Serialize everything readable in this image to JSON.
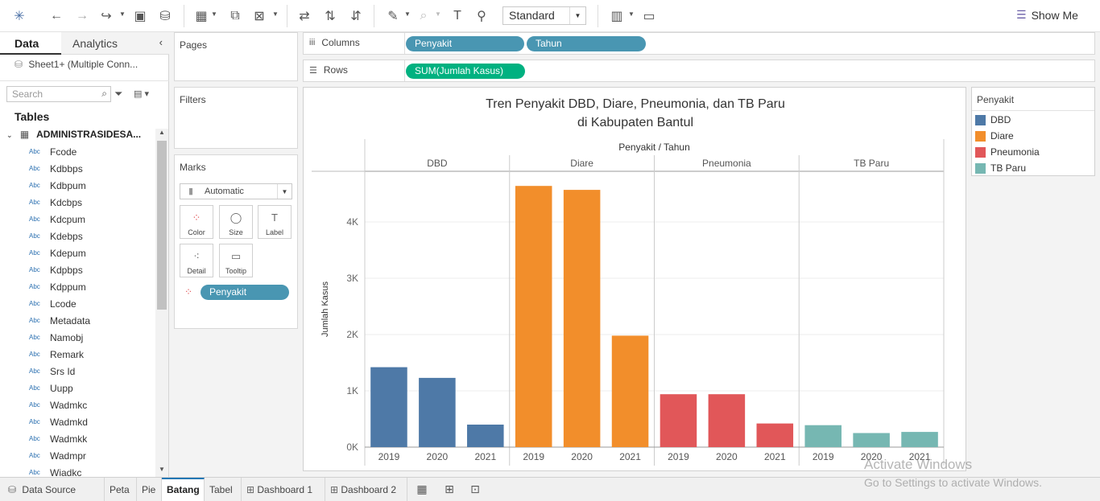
{
  "toolbar": {
    "fit_select": "Standard",
    "show_me": "Show Me"
  },
  "datapane": {
    "tab_data": "Data",
    "tab_analytics": "Analytics",
    "connection": "Sheet1+ (Multiple Conn...",
    "search_placeholder": "Search",
    "tables_heading": "Tables",
    "table_name": "ADMINISTRASIDESA...",
    "field_type": "Abc",
    "fields": [
      "Fcode",
      "Kdbbps",
      "Kdbpum",
      "Kdcbps",
      "Kdcpum",
      "Kdebps",
      "Kdepum",
      "Kdpbps",
      "Kdppum",
      "Lcode",
      "Metadata",
      "Namobj",
      "Remark",
      "Srs Id",
      "Uupp",
      "Wadmkc",
      "Wadmkd",
      "Wadmkk",
      "Wadmpr",
      "Wiadkc"
    ]
  },
  "cards": {
    "pages": "Pages",
    "filters": "Filters",
    "marks": "Marks",
    "marks_type": "Automatic",
    "mark_buttons": [
      "Color",
      "Size",
      "Label",
      "Detail",
      "Tooltip"
    ],
    "marks_pill": "Penyakit"
  },
  "shelves": {
    "columns_label": "Columns",
    "rows_label": "Rows",
    "columns_pills": [
      "Penyakit",
      "Tahun"
    ],
    "rows_pill": "SUM(Jumlah Kasus)"
  },
  "legend": {
    "title": "Penyakit",
    "items": [
      {
        "label": "DBD",
        "color": "#4e79a7"
      },
      {
        "label": "Diare",
        "color": "#f28e2b"
      },
      {
        "label": "Pneumonia",
        "color": "#e15759"
      },
      {
        "label": "TB Paru",
        "color": "#76b7b2"
      }
    ]
  },
  "chart_data": {
    "type": "bar",
    "title_line1": "Tren Penyakit DBD, Diare, Pneumonia, dan TB Paru",
    "title_line2": "di Kabupaten Bantul",
    "header": "Penyakit / Tahun",
    "ylabel": "Jumlah Kasus",
    "ylim": [
      0,
      4900
    ],
    "yticks": [
      {
        "v": 0,
        "label": "0K"
      },
      {
        "v": 1000,
        "label": "1K"
      },
      {
        "v": 2000,
        "label": "2K"
      },
      {
        "v": 3000,
        "label": "3K"
      },
      {
        "v": 4000,
        "label": "4K"
      }
    ],
    "grid": true,
    "groups": [
      {
        "name": "DBD",
        "color": "#4e79a7",
        "categories": [
          "2019",
          "2020",
          "2021"
        ],
        "values": [
          1420,
          1230,
          400
        ]
      },
      {
        "name": "Diare",
        "color": "#f28e2b",
        "categories": [
          "2019",
          "2020",
          "2021"
        ],
        "values": [
          4640,
          4570,
          1980
        ]
      },
      {
        "name": "Pneumonia",
        "color": "#e15759",
        "categories": [
          "2019",
          "2020",
          "2021"
        ],
        "values": [
          940,
          940,
          420
        ]
      },
      {
        "name": "TB Paru",
        "color": "#76b7b2",
        "categories": [
          "2019",
          "2020",
          "2021"
        ],
        "values": [
          390,
          250,
          270
        ]
      }
    ]
  },
  "bottom_tabs": {
    "data_source": "Data Source",
    "sheets": [
      "Peta",
      "Pie",
      "Batang",
      "Tabel",
      "Dashboard 1",
      "Dashboard 2"
    ],
    "active": "Batang"
  },
  "watermark": {
    "line1": "Activate Windows",
    "line2": "Go to Settings to activate Windows."
  }
}
